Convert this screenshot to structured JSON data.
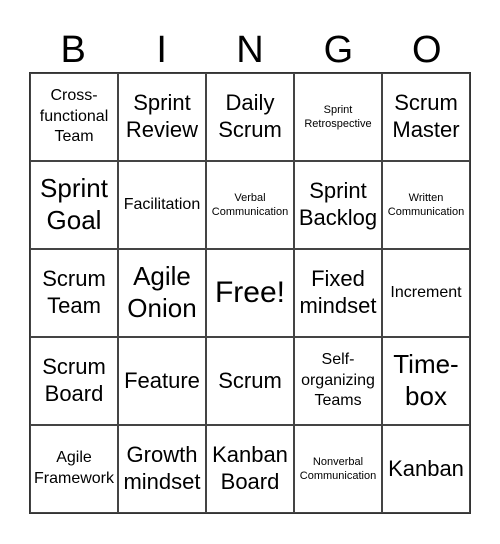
{
  "header": [
    "B",
    "I",
    "N",
    "G",
    "O"
  ],
  "cells": [
    {
      "text": "Cross-functional Team",
      "size": "m"
    },
    {
      "text": "Sprint Review",
      "size": "l"
    },
    {
      "text": "Daily Scrum",
      "size": "l"
    },
    {
      "text": "Sprint Retrospective",
      "size": "s"
    },
    {
      "text": "Scrum Master",
      "size": "l"
    },
    {
      "text": "Sprint Goal",
      "size": "xl"
    },
    {
      "text": "Facilitation",
      "size": "m"
    },
    {
      "text": "Verbal Communication",
      "size": "s"
    },
    {
      "text": "Sprint Backlog",
      "size": "l"
    },
    {
      "text": "Written Communication",
      "size": "s"
    },
    {
      "text": "Scrum Team",
      "size": "l"
    },
    {
      "text": "Agile Onion",
      "size": "xl"
    },
    {
      "text": "Free!",
      "size": "free"
    },
    {
      "text": "Fixed mindset",
      "size": "l"
    },
    {
      "text": "Increment",
      "size": "m"
    },
    {
      "text": "Scrum Board",
      "size": "l"
    },
    {
      "text": "Feature",
      "size": "l"
    },
    {
      "text": "Scrum",
      "size": "l"
    },
    {
      "text": "Self-organizing Teams",
      "size": "m"
    },
    {
      "text": "Time-box",
      "size": "xl"
    },
    {
      "text": "Agile Framework",
      "size": "m"
    },
    {
      "text": "Growth mindset",
      "size": "l"
    },
    {
      "text": "Kanban Board",
      "size": "l"
    },
    {
      "text": "Nonverbal Communication",
      "size": "s"
    },
    {
      "text": "Kanban",
      "size": "l"
    }
  ]
}
